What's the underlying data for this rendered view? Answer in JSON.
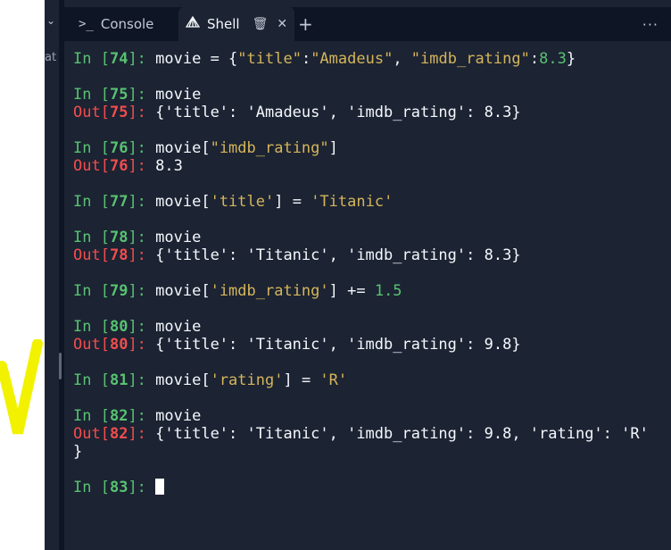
{
  "tabs": [
    {
      "label": "Console",
      "icon": "terminal-prompt-icon"
    },
    {
      "label": "Shell",
      "icon": "shell-icon"
    }
  ],
  "left_edge_text": "at",
  "session": [
    {
      "n": "74",
      "in": [
        [
          "plain",
          "movie = {"
        ],
        [
          "str",
          "\"title\""
        ],
        [
          "plain",
          ":"
        ],
        [
          "str",
          "\"Amadeus\""
        ],
        [
          "plain",
          ", "
        ],
        [
          "str",
          "\"imdb_rating\""
        ],
        [
          "plain",
          ":"
        ],
        [
          "num",
          "8.3"
        ],
        [
          "plain",
          "}"
        ]
      ]
    },
    {
      "n": "75",
      "in": [
        [
          "plain",
          "movie"
        ]
      ],
      "out": "{'title': 'Amadeus', 'imdb_rating': 8.3}"
    },
    {
      "n": "76",
      "in": [
        [
          "plain",
          "movie["
        ],
        [
          "str",
          "\"imdb_rating\""
        ],
        [
          "plain",
          "]"
        ]
      ],
      "out": "8.3"
    },
    {
      "n": "77",
      "in": [
        [
          "plain",
          "movie["
        ],
        [
          "str",
          "'title'"
        ],
        [
          "plain",
          "] = "
        ],
        [
          "str",
          "'Titanic'"
        ]
      ]
    },
    {
      "n": "78",
      "in": [
        [
          "plain",
          "movie"
        ]
      ],
      "out": "{'title': 'Titanic', 'imdb_rating': 8.3}"
    },
    {
      "n": "79",
      "in": [
        [
          "plain",
          "movie["
        ],
        [
          "str",
          "'imdb_rating'"
        ],
        [
          "plain",
          "] += "
        ],
        [
          "num",
          "1.5"
        ]
      ]
    },
    {
      "n": "80",
      "in": [
        [
          "plain",
          "movie"
        ]
      ],
      "out": "{'title': 'Titanic', 'imdb_rating': 9.8}"
    },
    {
      "n": "81",
      "in": [
        [
          "plain",
          "movie["
        ],
        [
          "str",
          "'rating'"
        ],
        [
          "plain",
          "] = "
        ],
        [
          "str",
          "'R'"
        ]
      ]
    },
    {
      "n": "82",
      "in": [
        [
          "plain",
          "movie"
        ]
      ],
      "out": "{'title': 'Titanic', 'imdb_rating': 9.8, 'rating': 'R'",
      "out_cont": "}"
    },
    {
      "n": "83",
      "in": [],
      "cursor": true
    }
  ],
  "prompt_in": "In",
  "prompt_out": "Out",
  "colors": {
    "in": "#58c271",
    "out": "#f24d4d",
    "string": "#d4b55a",
    "number": "#58c271",
    "bg": "#1c2333"
  }
}
